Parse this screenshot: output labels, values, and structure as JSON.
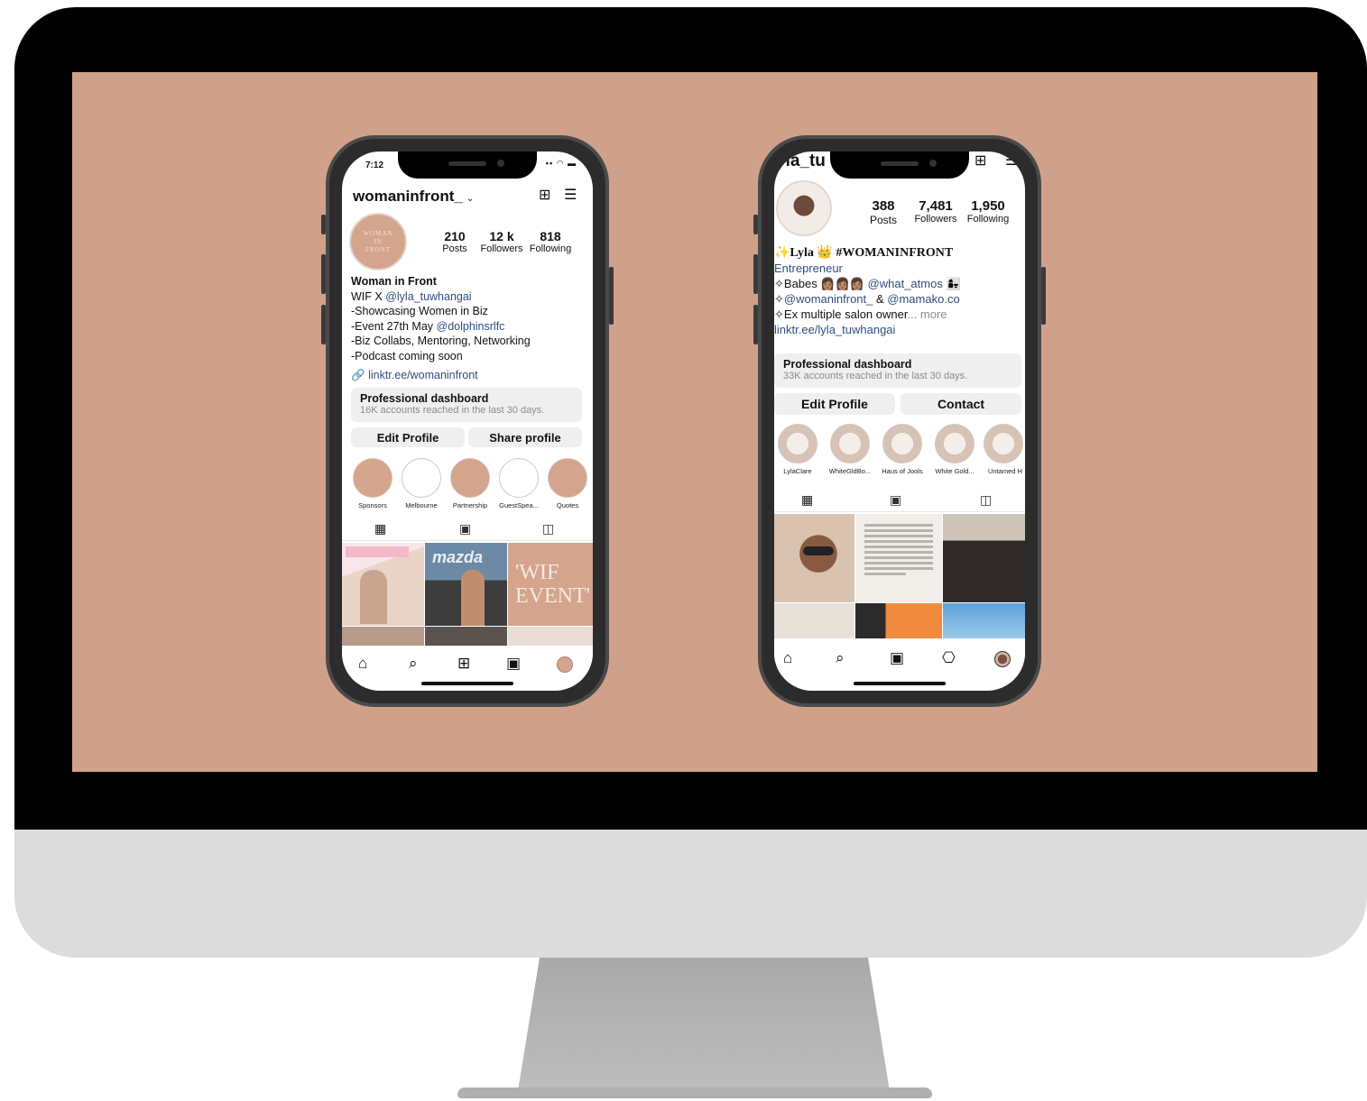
{
  "left_phone": {
    "status_time": "7:12",
    "status_icons": "▪▪ ◠ ▬",
    "username": "womaninfront_",
    "avatar_text_1": "WOMAN",
    "avatar_text_2": "IN",
    "avatar_text_3": "FRONT",
    "stats": [
      {
        "num": "210",
        "label": "Posts"
      },
      {
        "num": "12 k",
        "label": "Followers"
      },
      {
        "num": "818",
        "label": "Following"
      }
    ],
    "bio_name": "Woman in Front",
    "bio_line1_prefix": "WIF X ",
    "bio_line1_link": "@lyla_tuwhangai",
    "bio_line2": "-Showcasing Women in Biz",
    "bio_line3_prefix": "-Event 27th May ",
    "bio_line3_link": "@dolphinsrlfc",
    "bio_line4": "-Biz Collabs, Mentoring, Networking",
    "bio_line5": "-Podcast coming soon",
    "website": "linktr.ee/womaninfront",
    "dashboard_title": "Professional dashboard",
    "dashboard_sub": "16K accounts reached in the last 30 days.",
    "btn_edit": "Edit Profile",
    "btn_share": "Share profile",
    "highlights": [
      "Sponsors",
      "Melbourne",
      "Partnership",
      "GuestSpea...",
      "Quotes"
    ],
    "grid_text_1": "'WIF",
    "grid_text_2": "EVENT'",
    "grid_text_brand": "mazda"
  },
  "right_phone": {
    "username_partial": "yla_tu",
    "stats": [
      {
        "num": "388",
        "label": "Posts"
      },
      {
        "num": "7,481",
        "label": "Followers"
      },
      {
        "num": "1,950",
        "label": "Following"
      }
    ],
    "bio_name": "✨Lyla 👑 #WOMANINFRONT",
    "bio_category": "Entrepreneur",
    "bio_line1_prefix": "✧Babes 👩🏽👩🏽👩🏽 ",
    "bio_line1_link": "@what_atmos",
    "bio_line1_suffix": " 👩‍👧",
    "bio_line2_link_a": "@womaninfront_",
    "bio_line2_mid": " & ",
    "bio_line2_link_b": "@mamako.co",
    "bio_line3": "✧Ex multiple salon owner",
    "bio_more": "... more",
    "website": "linktr.ee/lyla_tuwhangai",
    "dashboard_title": "Professional dashboard",
    "dashboard_sub": "33K accounts reached in the last 30 days.",
    "btn_edit": "Edit Profile",
    "btn_contact": "Contact",
    "highlights": [
      "LylaClare",
      "WhiteGldBo...",
      "Haus of Jools",
      "White Gold...",
      "Untamed H"
    ]
  },
  "colors": {
    "screen_bg": "#cfa18a",
    "brand_tan": "#d4a48c",
    "link_blue": "#2e4e7e"
  }
}
